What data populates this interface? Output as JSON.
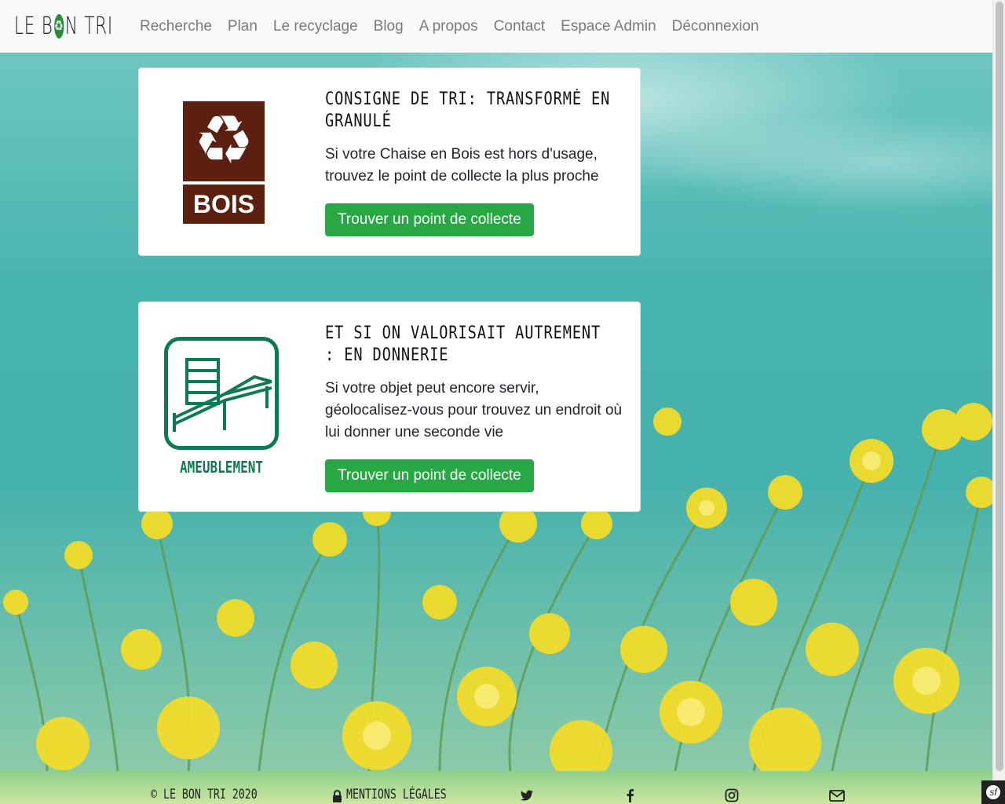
{
  "brand": {
    "text_left": "LE B",
    "logo_glyph": "♻",
    "text_right": "N TRI"
  },
  "nav": {
    "items": [
      {
        "label": "Recherche"
      },
      {
        "label": "Plan"
      },
      {
        "label": "Le recyclage"
      },
      {
        "label": "Blog"
      },
      {
        "label": "A propos"
      },
      {
        "label": "Contact"
      },
      {
        "label": "Espace Admin"
      },
      {
        "label": "Déconnexion"
      }
    ]
  },
  "cards": [
    {
      "title": "Consigne de tri: transformé en granulé",
      "text": "Si votre Chaise en Bois est hors d'usage, trouvez le point de collecte la plus proche",
      "button": "Trouver un point de collecte",
      "image_label": "BOIS",
      "image_icon": "recycle-icon"
    },
    {
      "title": "Et si on valorisait autrement : en donnerie",
      "text": "Si votre objet peut encore servir, géolocalisez-vous pour trouvez un endroit où lui donner une seconde vie",
      "button": "Trouver un point de collecte",
      "image_label": "AMEUBLEMENT",
      "image_icon": "bed-furniture-icon"
    }
  ],
  "footer": {
    "copyright": "© LE BON TRI 2020",
    "legal": "MENTIONS LÉGALES",
    "icons": [
      "twitter-icon",
      "facebook-icon",
      "instagram-icon",
      "envelope-icon"
    ]
  },
  "colors": {
    "brand_green": "#28a745",
    "bois_brown": "#5b2010",
    "ameublement_green": "#0d7a55"
  }
}
